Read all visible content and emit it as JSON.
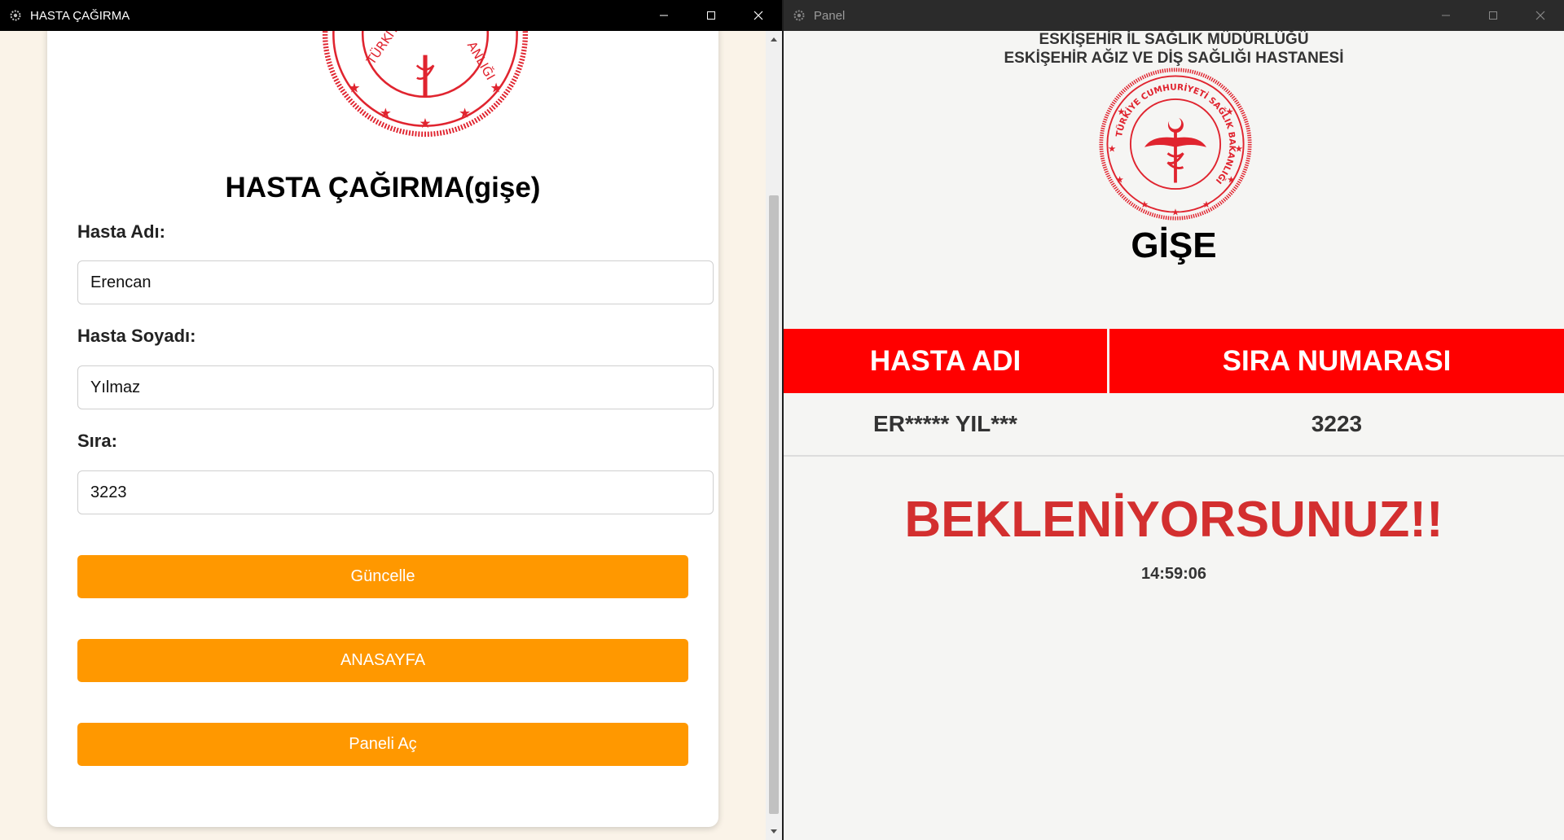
{
  "left_window": {
    "title": "HASTA ÇAĞIRMA",
    "icon": "app-gear-icon",
    "controls": [
      "minimize-icon",
      "maximize-icon",
      "close-icon"
    ],
    "form": {
      "title": "HASTA ÇAĞIRMA(gişe)",
      "name_label": "Hasta Adı:",
      "name_value": "Erencan",
      "surname_label": "Hasta Soyadı:",
      "surname_value": "Yılmaz",
      "queue_label": "Sıra:",
      "queue_value": "3223",
      "update_button": "Güncelle",
      "home_button": "ANASAYFA",
      "open_panel_button": "Paneli Aç"
    },
    "colors": {
      "button": "#ff9800",
      "background": "#faf3e8",
      "seal": "#e0242f"
    }
  },
  "right_window": {
    "title": "Panel",
    "icon": "app-gear-icon",
    "controls": [
      "minimize-icon",
      "maximize-icon",
      "close-icon"
    ],
    "header_line1": "ESKİŞEHİR İL SAĞLIK MÜDÜRLÜĞÜ",
    "header_line2": "ESKİŞEHİR AĞIZ VE DİŞ SAĞLIĞI HASTANESİ",
    "seal_text": "TÜRKİYE CUMHURİYETİ SAĞLIK BAKANLIĞI",
    "desk_title": "GİŞE",
    "table": {
      "headers": [
        "HASTA ADI",
        "SIRA NUMARASI"
      ],
      "rows": [
        [
          "ER***** YIL***",
          "3223"
        ]
      ]
    },
    "status_message": "BEKLENİYORSUNUZ!!",
    "clock": "14:59:06",
    "colors": {
      "header": "#ff0000",
      "status": "#d32f2f",
      "background": "#f5f5f3"
    }
  }
}
